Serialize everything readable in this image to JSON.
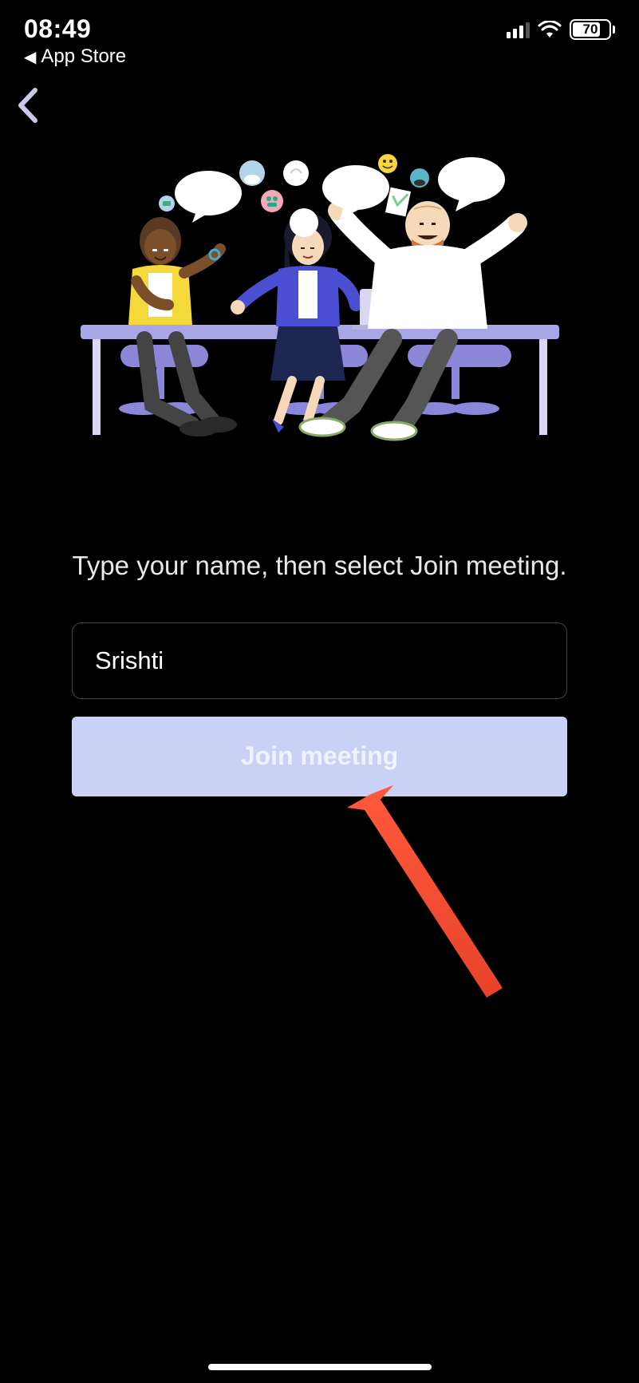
{
  "status_bar": {
    "time": "08:49",
    "back_app_label": "App Store",
    "battery_percent": "70"
  },
  "nav": {
    "back_icon": "chevron-left"
  },
  "main": {
    "instruction": "Type your name, then select Join meeting.",
    "name_field_value": "Srishti",
    "name_field_placeholder": "",
    "join_button_label": "Join meeting"
  }
}
